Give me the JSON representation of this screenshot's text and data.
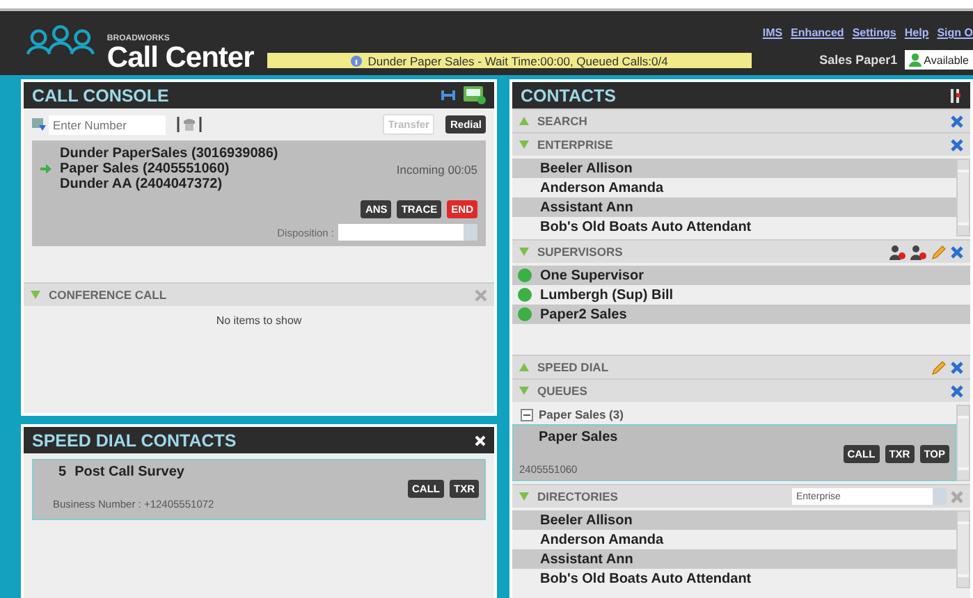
{
  "header": {
    "brand_small": "BROADWORKS",
    "brand": "Call Center",
    "banner": "Dunder Paper Sales - Wait Time:00:00, Queued Calls:0/4",
    "links": [
      "IMS",
      "Enhanced",
      "Settings",
      "Help",
      "Sign O"
    ],
    "user": "Sales Paper1",
    "status": "Available"
  },
  "call_console": {
    "title": "CALL CONSOLE",
    "number_placeholder": "Enter Number",
    "buttons": [
      {
        "label": "Transfer",
        "disabled": true
      },
      {
        "label": "Redial",
        "disabled": false
      }
    ],
    "calls": [
      {
        "lines": [
          "Dunder PaperSales (3016939086)",
          "Paper Sales (2405551060)",
          "Dunder AA (2404047372)"
        ],
        "status": "Incoming 00:05",
        "actions": [
          {
            "label": "ANS",
            "kind": "normal"
          },
          {
            "label": "TRACE",
            "kind": "normal"
          },
          {
            "label": "END",
            "kind": "danger"
          }
        ],
        "disposition_label": "Disposition :"
      }
    ]
  },
  "conference_call": {
    "title": "CONFERENCE CALL",
    "expanded": true,
    "empty_text": "No items to show"
  },
  "speed_dial_contacts": {
    "title": "SPEED DIAL CONTACTS",
    "items": [
      {
        "code": "5",
        "name": "Post Call Survey",
        "detail": "Business Number : +12405551072",
        "actions": [
          "CALL",
          "TXR"
        ]
      }
    ]
  },
  "contacts": {
    "title": "CONTACTS",
    "sections": [
      {
        "title": "SEARCH",
        "kind": "search",
        "expanded": false
      },
      {
        "title": "ENTERPRISE",
        "kind": "list",
        "expanded": true,
        "items": [
          "Beeler Allison",
          "Anderson Amanda",
          "Assistant Ann",
          "Bob's Old Boats Auto Attendant"
        ]
      },
      {
        "title": "SUPERVISORS",
        "kind": "presence",
        "expanded": true,
        "items": [
          {
            "name": "One Supervisor",
            "color": "#3cb043"
          },
          {
            "name": "Lumbergh (Sup) Bill",
            "color": "#3cb043"
          },
          {
            "name": "Paper2 Sales",
            "color": "#3cb043"
          }
        ]
      },
      {
        "title": "SPEED DIAL",
        "kind": "speed_dial",
        "expanded": false
      },
      {
        "title": "QUEUES",
        "kind": "queues",
        "expanded": true,
        "groups": [
          {
            "name": "Paper Sales (3)",
            "expanded": true,
            "items": [
              {
                "name": "Paper Sales",
                "number": "2405551060",
                "actions": [
                  "CALL",
                  "TXR",
                  "TOP"
                ]
              }
            ]
          }
        ]
      },
      {
        "title": "DIRECTORIES",
        "kind": "directory",
        "expanded": true,
        "filter": "Enterprise",
        "items": [
          "Beeler Allison",
          "Anderson Amanda",
          "Assistant Ann",
          "Bob's Old Boats Auto Attendant"
        ]
      }
    ]
  }
}
